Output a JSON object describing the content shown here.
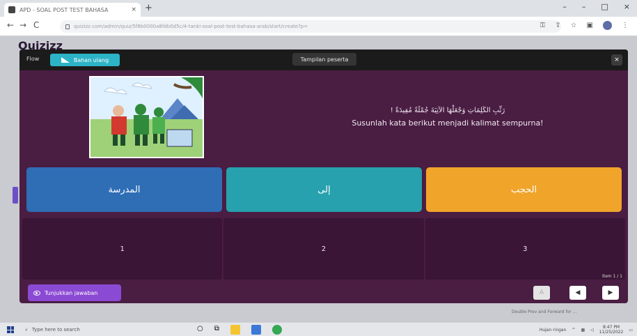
{
  "browser": {
    "tab_title": "APD - SOAL POST TEST BAHASA",
    "tab_close": "×",
    "new_tab": "+",
    "window_controls": [
      "–",
      "–",
      "□",
      "×"
    ],
    "url": "quizizz.com/admin/quiz/5f8b0000a8fdb0d5c/4-tanki-soal-post-test-bahasa-arab/start/create?p=",
    "nav": {
      "back": "←",
      "forward": "→",
      "reload": "C"
    }
  },
  "page": {
    "logo": "Quizizz"
  },
  "modal": {
    "header_left": "Flow",
    "header_tab": "Bahan ulang",
    "header_center": "Tampilan peserta",
    "close": "×",
    "question_arabic": "رَتِّبِ الكَلِمَاتِ وَجْعَلْهَا الآتِيَةَ جُمْلَةً مُفِيدَةً !",
    "question_latin": "Susunlah kata berikut menjadi kalimat sempurna!",
    "options": [
      "المدرسة",
      "إلى",
      "الحجب"
    ],
    "slots": [
      "1",
      "2",
      "3"
    ],
    "page_indicator": "Item 1 / 1",
    "show_answer": "Tunjukkan jawaban",
    "controls": {
      "a": "A",
      "prev": "◀",
      "next": "▶"
    }
  },
  "hint": "Double Prev and Forward for ...",
  "taskbar": {
    "search_placeholder": "Type here to search",
    "tray_text": "Hujan ringan",
    "time": "8:47 PM",
    "date": "11/25/2022"
  },
  "colors": {
    "modal_bg": "#4a1d43",
    "option_blue": "#2f6db5",
    "option_teal": "#26a1ad",
    "option_orange": "#f0a42a",
    "show_answer_purple": "#8b4ad3",
    "header_tab_cyan": "#2cb3c6"
  }
}
